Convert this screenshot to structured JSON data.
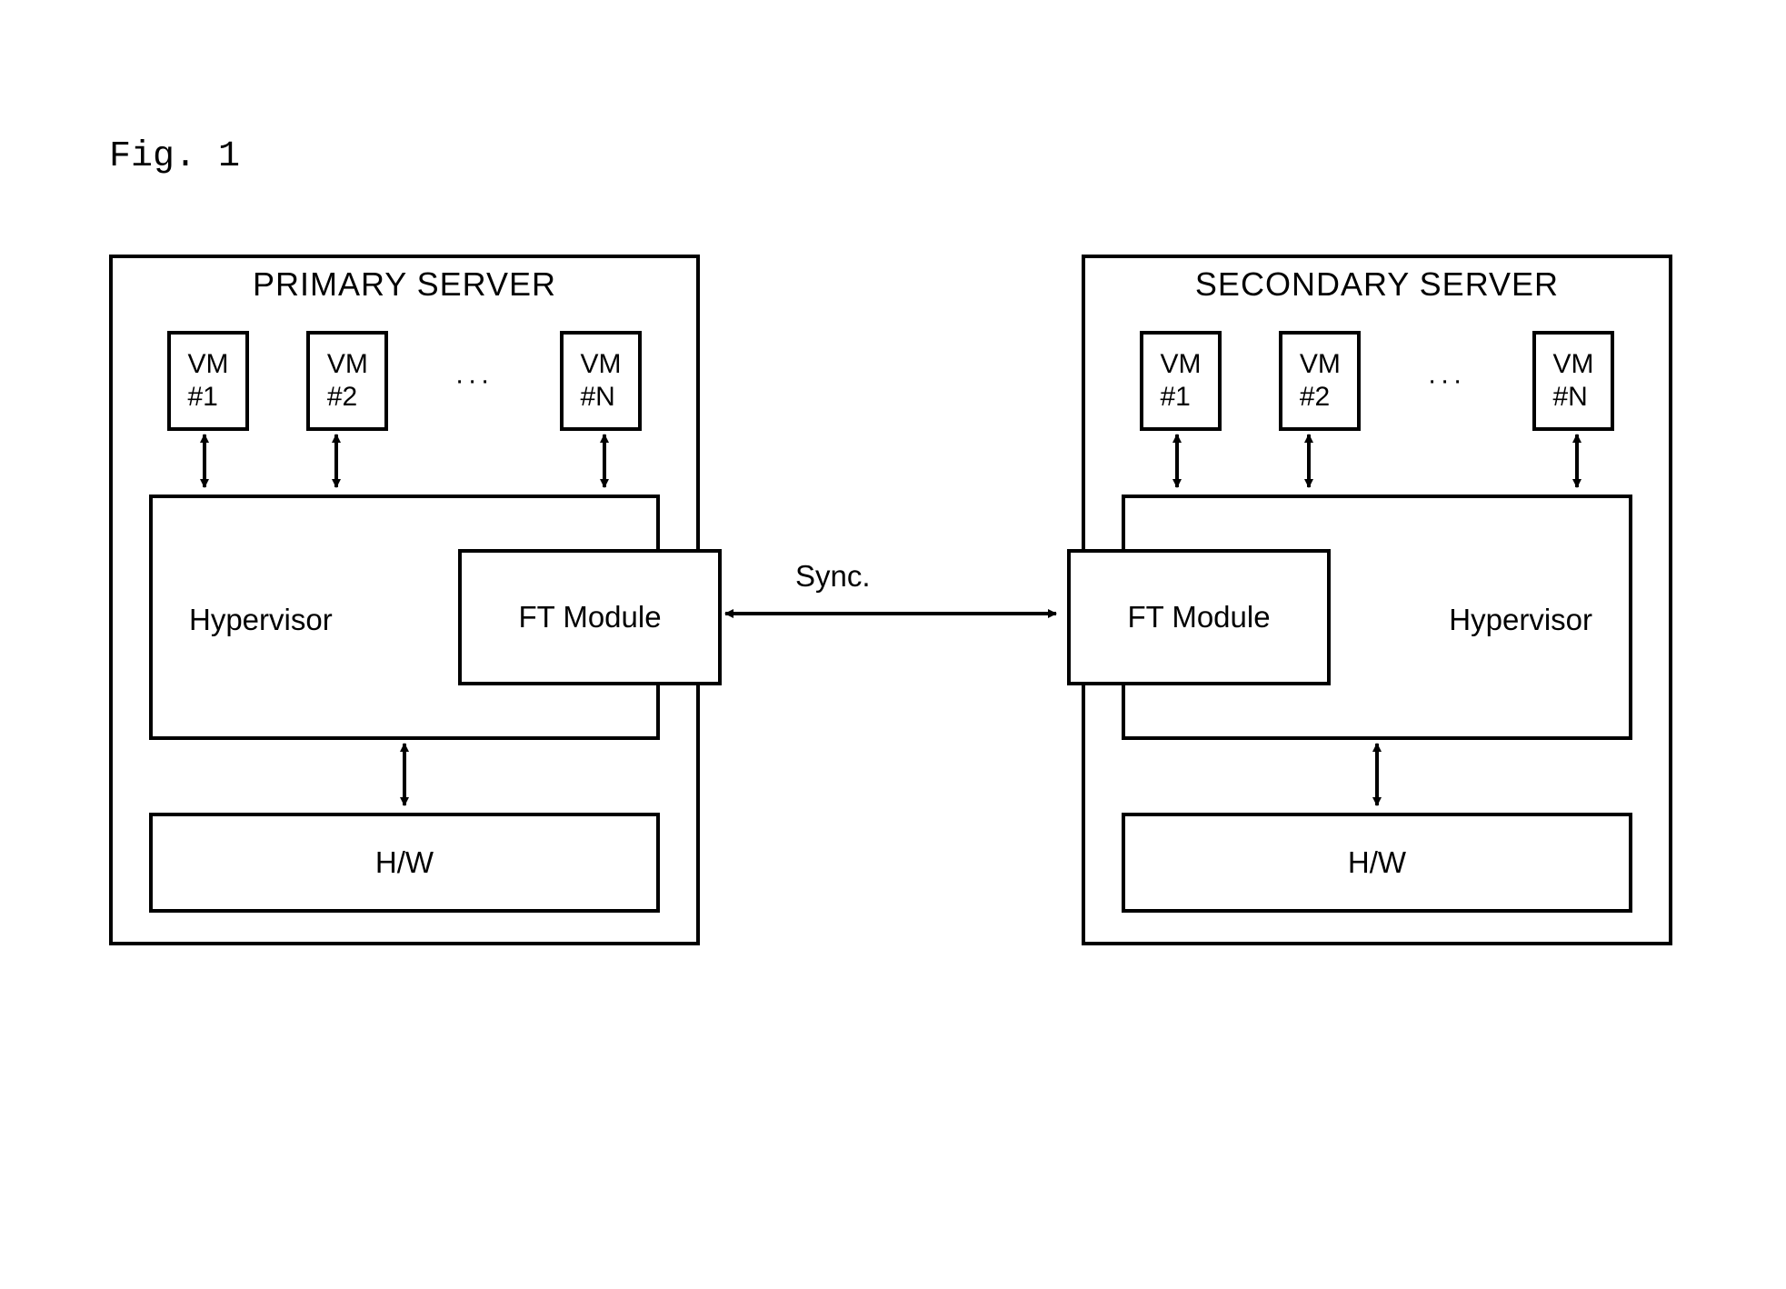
{
  "figure_label": "Fig. 1",
  "primary": {
    "title": "PRIMARY SERVER",
    "vms": [
      "VM\n#1",
      "VM\n#2",
      "VM\n#N"
    ],
    "vm_ellipsis": "···",
    "hypervisor_label": "Hypervisor",
    "ft_label": "FT Module",
    "hw_label": "H/W"
  },
  "secondary": {
    "title": "SECONDARY SERVER",
    "vms": [
      "VM\n#1",
      "VM\n#2",
      "VM\n#N"
    ],
    "vm_ellipsis": "···",
    "hypervisor_label": "Hypervisor",
    "ft_label": "FT Module",
    "hw_label": "H/W"
  },
  "sync_label": "Sync."
}
